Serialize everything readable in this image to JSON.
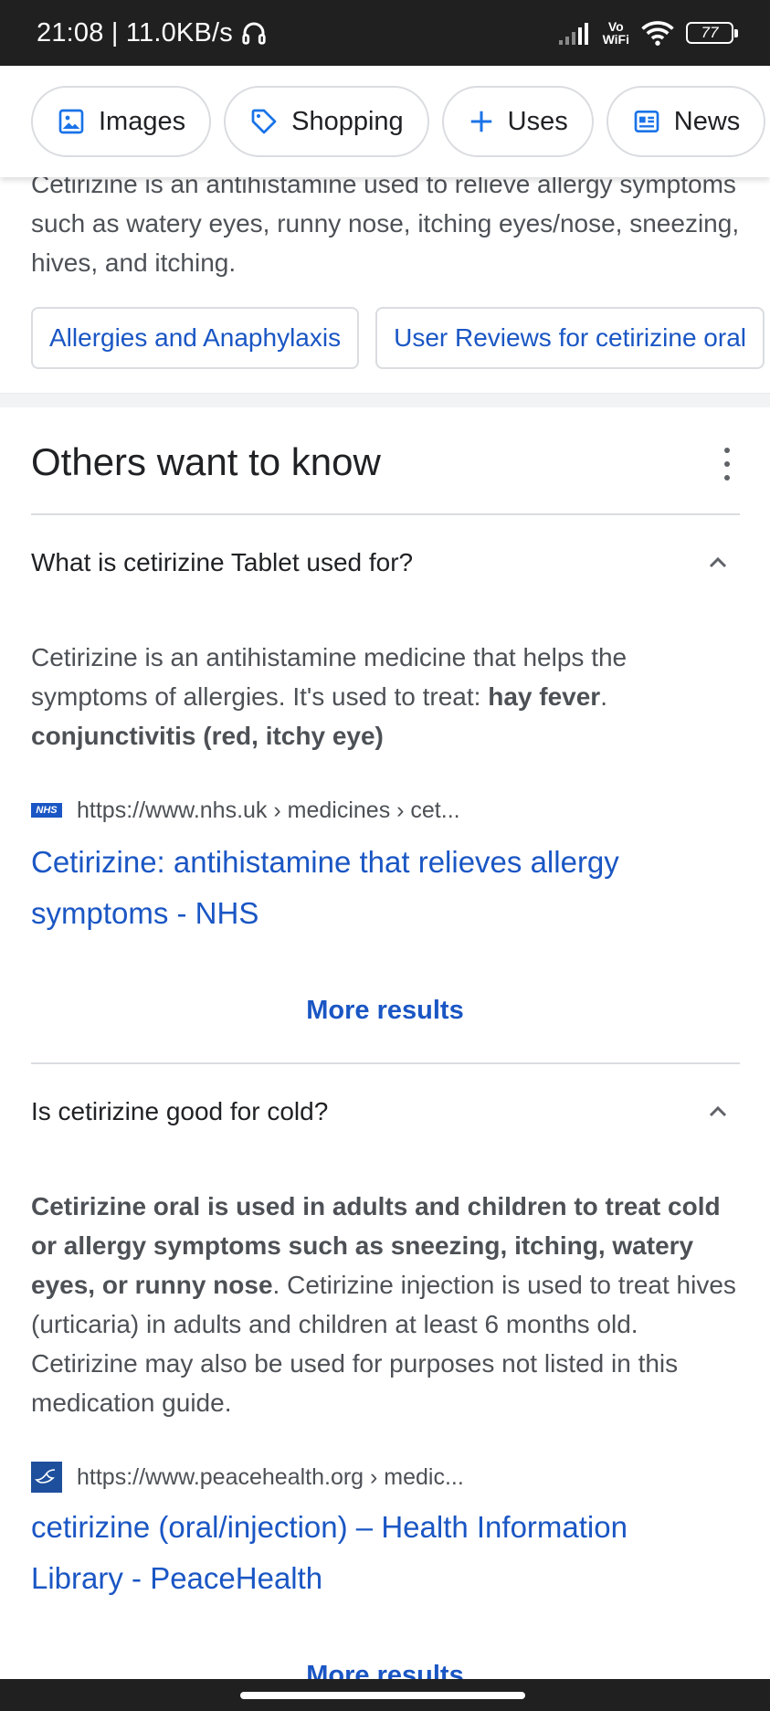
{
  "status_bar": {
    "time_speed": "21:08 | 11.0KB/s",
    "vowifi_top": "Vo",
    "vowifi_bottom": "WiFi",
    "battery": "77"
  },
  "chips": [
    {
      "label": "Images",
      "icon": "image-icon"
    },
    {
      "label": "Shopping",
      "icon": "tag-icon"
    },
    {
      "label": "Uses",
      "icon": "plus-icon"
    },
    {
      "label": "News",
      "icon": "news-icon"
    }
  ],
  "snippet": {
    "text": "Cetirizine is an antihistamine used to relieve allergy symptoms such as watery eyes, runny nose, itching eyes/nose, sneezing, hives, and itching.",
    "links": [
      "Allergies and Anaphylaxis",
      "User Reviews for cetirizine oral"
    ]
  },
  "others_want_to_know": {
    "title": "Others want to know",
    "items": [
      {
        "question": "What is cetirizine Tablet used for?",
        "answer_plain_1": "Cetirizine is an antihistamine medicine that helps the symptoms of allergies. It's used to treat: ",
        "answer_bold_1": "hay fever",
        "answer_plain_2": ". ",
        "answer_bold_2": "conjunctivitis (red, itchy eye)",
        "source_favicon_text": "NHS",
        "source_url": "https://www.nhs.uk › medicines › cet...",
        "result_title": "Cetirizine: antihistamine that relieves allergy symptoms - NHS",
        "more": "More results"
      },
      {
        "question": "Is cetirizine good for cold?",
        "answer_bold_1": "Cetirizine oral is used in adults and children to treat cold or allergy symptoms such as sneezing, itching, watery eyes, or runny nose",
        "answer_plain_1": ". Cetirizine injection is used to treat hives (urticaria) in adults and children at least 6 months old. Cetirizine may also be used for purposes not listed in this medication guide.",
        "source_url": "https://www.peacehealth.org › medic...",
        "result_title": "cetirizine (oral/injection) – Health Information Library - PeaceHealth",
        "more": "More results"
      }
    ]
  },
  "colors": {
    "link": "#1a56c4",
    "text": "#4d5156",
    "status_bar": "#202020"
  }
}
